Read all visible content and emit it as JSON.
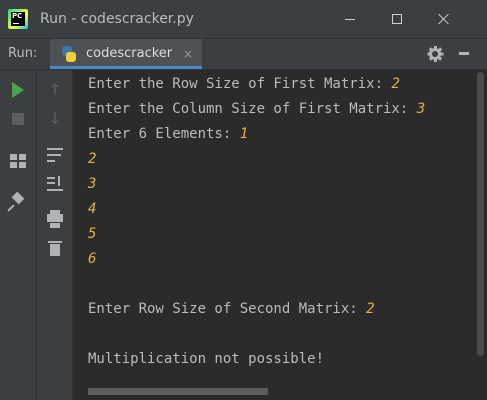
{
  "window": {
    "title": "Run - codescracker.py",
    "minimize_icon": "minimize-icon",
    "maximize_icon": "maximize-icon",
    "close_icon": "close-icon"
  },
  "run_panel": {
    "label": "Run:",
    "tab": {
      "label": "codescracker",
      "icon": "python-file-icon",
      "close": "×"
    },
    "settings_icon": "gear-icon",
    "hide_icon": "hide-panel-icon"
  },
  "toolbar_left": {
    "items": [
      "rerun-icon",
      "stop-icon",
      "layout-icon",
      "pin-icon"
    ]
  },
  "toolbar_right": {
    "items": [
      "up-arrow-icon",
      "down-arrow-icon",
      "soft-wrap-icon",
      "scroll-to-end-icon",
      "print-icon",
      "trash-icon"
    ]
  },
  "console": {
    "lines": [
      {
        "prompt": "Enter the Row Size of First Matrix: ",
        "input": "2"
      },
      {
        "prompt": "Enter the Column Size of First Matrix: ",
        "input": "3"
      },
      {
        "prompt": "Enter 6 Elements: ",
        "input": "1"
      },
      {
        "prompt": "",
        "input": "2"
      },
      {
        "prompt": "",
        "input": "3"
      },
      {
        "prompt": "",
        "input": "4"
      },
      {
        "prompt": "",
        "input": "5"
      },
      {
        "prompt": "",
        "input": "6"
      },
      {
        "prompt": "",
        "input": ""
      },
      {
        "prompt": "Enter Row Size of Second Matrix: ",
        "input": "2"
      },
      {
        "prompt": "",
        "input": ""
      },
      {
        "prompt": "Multiplication not possible!",
        "input": ""
      }
    ]
  },
  "colors": {
    "background": "#2b2b2b",
    "panel": "#3c3f41",
    "output_text": "#bbbbbb",
    "user_input": "#e3b341",
    "run_green": "#4fa34e",
    "tab_underline": "#4a88c7"
  }
}
